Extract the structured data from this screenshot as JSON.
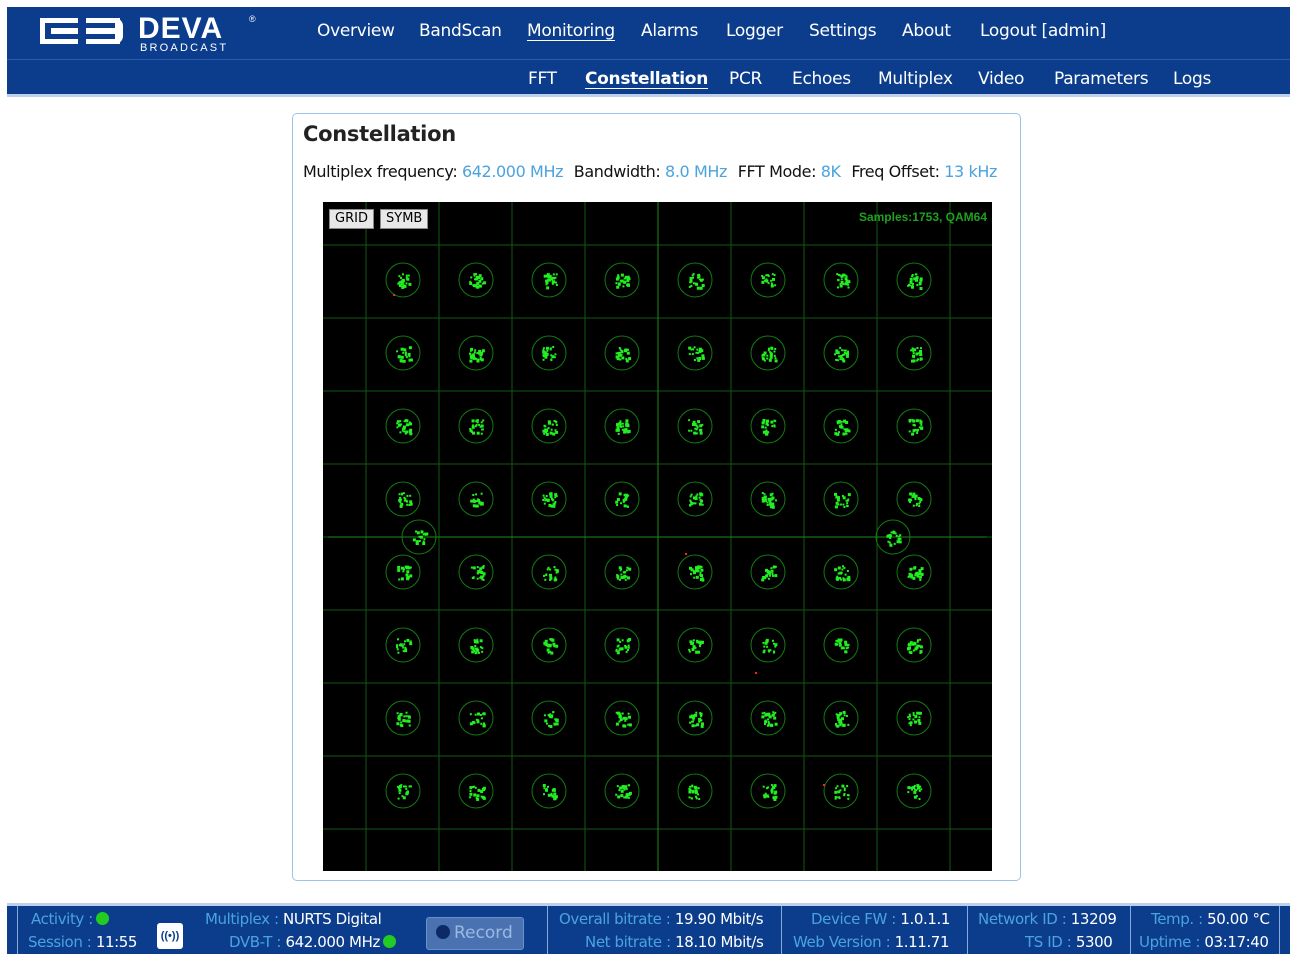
{
  "brand": {
    "name": "DEVA",
    "sub": "BROADCAST",
    "reg": "®"
  },
  "nav": {
    "items": [
      {
        "label": "Overview"
      },
      {
        "label": "BandScan"
      },
      {
        "label": "Monitoring",
        "active": true
      },
      {
        "label": "Alarms"
      },
      {
        "label": "Logger"
      },
      {
        "label": "Settings"
      },
      {
        "label": "About"
      },
      {
        "label": "Logout [admin]"
      }
    ]
  },
  "subnav": {
    "items": [
      {
        "label": "FFT"
      },
      {
        "label": "Constellation",
        "active": true
      },
      {
        "label": "PCR"
      },
      {
        "label": "Echoes"
      },
      {
        "label": "Multiplex"
      },
      {
        "label": "Video"
      },
      {
        "label": "Parameters"
      },
      {
        "label": "Logs"
      }
    ]
  },
  "panel": {
    "title": "Constellation",
    "info": [
      {
        "label": "Multiplex frequency:",
        "value": "642.000 MHz"
      },
      {
        "label": "Bandwidth:",
        "value": "8.0 MHz"
      },
      {
        "label": "FFT Mode:",
        "value": "8K"
      },
      {
        "label": "Freq Offset:",
        "value": "13 kHz"
      }
    ],
    "buttons": {
      "grid": "GRID",
      "symb": "SYMB"
    },
    "samples_text": "Samples:1753, QAM64",
    "modulation": "QAM64",
    "samples": 1753,
    "colors": {
      "background": "#000000",
      "grid": "#0f5a0f",
      "points": "#22ee22",
      "errors": "#ff2222"
    }
  },
  "footer": {
    "activity_label": "Activity :",
    "session_label": "Session :",
    "session_value": "11:55",
    "radio_icon": "((•))",
    "multiplex_label": "Multiplex :",
    "multiplex_value": "NURTS Digital",
    "dvbt_label": "DVB-T :",
    "dvbt_value": "642.000 MHz",
    "record_label": "Record",
    "overall_label": "Overall bitrate :",
    "overall_value": "19.90 Mbit/s",
    "net_label": "Net bitrate :",
    "net_value": "18.10 Mbit/s",
    "fw_label": "Device FW :",
    "fw_value": "1.0.1.1",
    "web_label": "Web Version :",
    "web_value": "1.11.71",
    "netid_label": "Network ID :",
    "netid_value": "13209",
    "tsid_label": "TS ID :",
    "tsid_value": "5300",
    "temp_label": "Temp. :",
    "temp_value": "50.00 °C",
    "uptime_label": "Uptime :",
    "uptime_value": "03:17:40"
  }
}
